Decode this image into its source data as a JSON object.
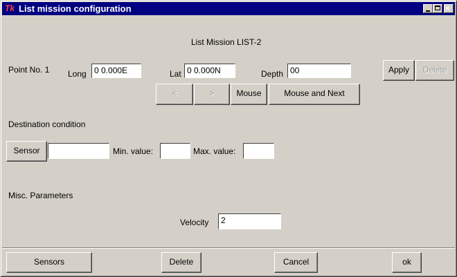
{
  "window": {
    "title": "List mission configuration",
    "logo": "Tk"
  },
  "header": {
    "mission_title": "List Mission LIST-2"
  },
  "point": {
    "label": "Point No.  1",
    "long_label": "Long",
    "long_value": "0 0.000E",
    "lat_label": "Lat",
    "lat_value": "0 0.000N",
    "depth_label": "Depth",
    "depth_value": "00",
    "apply_label": "Apply",
    "delete_label": "Delete",
    "prev_label": "<",
    "next_label": ">",
    "mouse_label": "Mouse",
    "mouse_next_label": "Mouse and Next"
  },
  "destination": {
    "heading": "Destination condition",
    "sensor_label": "Sensor",
    "sensor_value": "",
    "min_label": "Min. value:",
    "min_value": "",
    "max_label": "Max. value:",
    "max_value": ""
  },
  "misc": {
    "heading": "Misc. Parameters",
    "velocity_label": "Velocity",
    "velocity_value": "2"
  },
  "footer": {
    "sensors_label": "Sensors",
    "delete_label": "Delete",
    "cancel_label": "Cancel",
    "ok_label": "ok"
  }
}
